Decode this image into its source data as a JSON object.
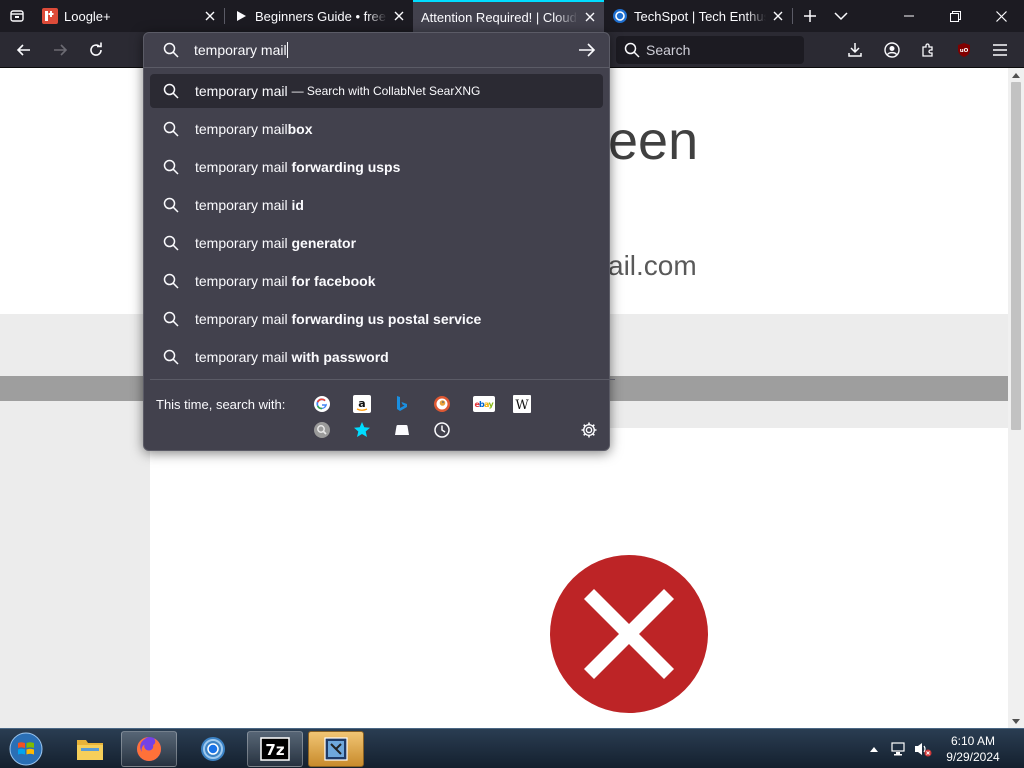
{
  "tabs": [
    {
      "title": "Loogle+",
      "favicon": "loogle-plus-icon",
      "active": false
    },
    {
      "title": "Beginners Guide • freeme",
      "favicon": "play-icon",
      "active": false
    },
    {
      "title": "Attention Required! | Cloudfla",
      "favicon": "none",
      "active": true
    },
    {
      "title": "TechSpot | Tech Enthusias",
      "favicon": "techspot-icon",
      "active": false
    }
  ],
  "searchbar": {
    "placeholder": "Search"
  },
  "urlbar": {
    "value": "temporary mail",
    "results": [
      {
        "prefix": "temporary mail",
        "suffix": "",
        "action": "— Search with CollabNet SearXNG",
        "selected": true
      },
      {
        "prefix": "temporary mail",
        "suffix": "box",
        "action": "",
        "selected": false
      },
      {
        "prefix": "temporary mail",
        "suffix": " forwarding usps",
        "action": "",
        "selected": false
      },
      {
        "prefix": "temporary mail",
        "suffix": " id",
        "action": "",
        "selected": false
      },
      {
        "prefix": "temporary mail",
        "suffix": " generator",
        "action": "",
        "selected": false
      },
      {
        "prefix": "temporary mail",
        "suffix": " for facebook",
        "action": "",
        "selected": false
      },
      {
        "prefix": "temporary mail",
        "suffix": " forwarding us postal service",
        "action": "",
        "selected": false
      },
      {
        "prefix": "temporary mail",
        "suffix": " with password",
        "action": "",
        "selected": false
      }
    ],
    "oneoff_label": "This time, search with:",
    "engines": [
      "google-icon",
      "amazon-icon",
      "bing-icon",
      "duckduckgo-icon",
      "ebay-icon",
      "wikipedia-icon",
      "searxng-icon",
      "bookmarks-star-icon",
      "tabs-icon",
      "history-clock-icon"
    ]
  },
  "page": {
    "heading_fragment": "een",
    "domain_fragment": "ail.com"
  },
  "taskbar": {
    "apps": [
      "firefox-icon",
      "chrome-icon",
      "7zip-icon",
      "app-icon"
    ],
    "time": "6:10 AM",
    "date": "9/29/2024"
  },
  "colors": {
    "accent": "#00ddff",
    "error_red": "#bd2426",
    "popup_bg": "#42414d"
  }
}
